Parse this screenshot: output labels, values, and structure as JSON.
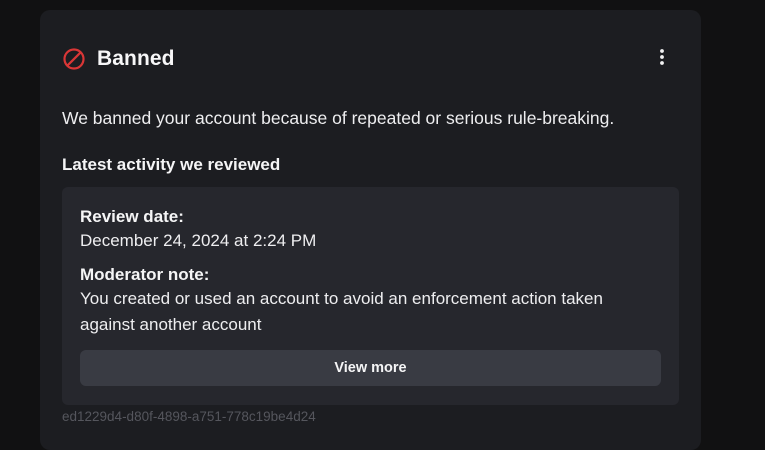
{
  "card": {
    "title": "Banned",
    "status_icon": "ban-icon",
    "status_color": "#d93636",
    "menu_icon": "vertical-ellipsis-icon",
    "description": "We banned your account because of repeated or serious rule-breaking.",
    "section_heading": "Latest activity we reviewed",
    "activity": {
      "review_date_label": "Review date:",
      "review_date_value": "December 24, 2024 at 2:24 PM",
      "moderator_note_label": "Moderator note:",
      "moderator_note_value": "You created or used an account to avoid an enforcement action taken against another account",
      "view_more_label": "View more"
    },
    "reference_id": "ed1229d4-d80f-4898-a751-778c19be4d24"
  }
}
